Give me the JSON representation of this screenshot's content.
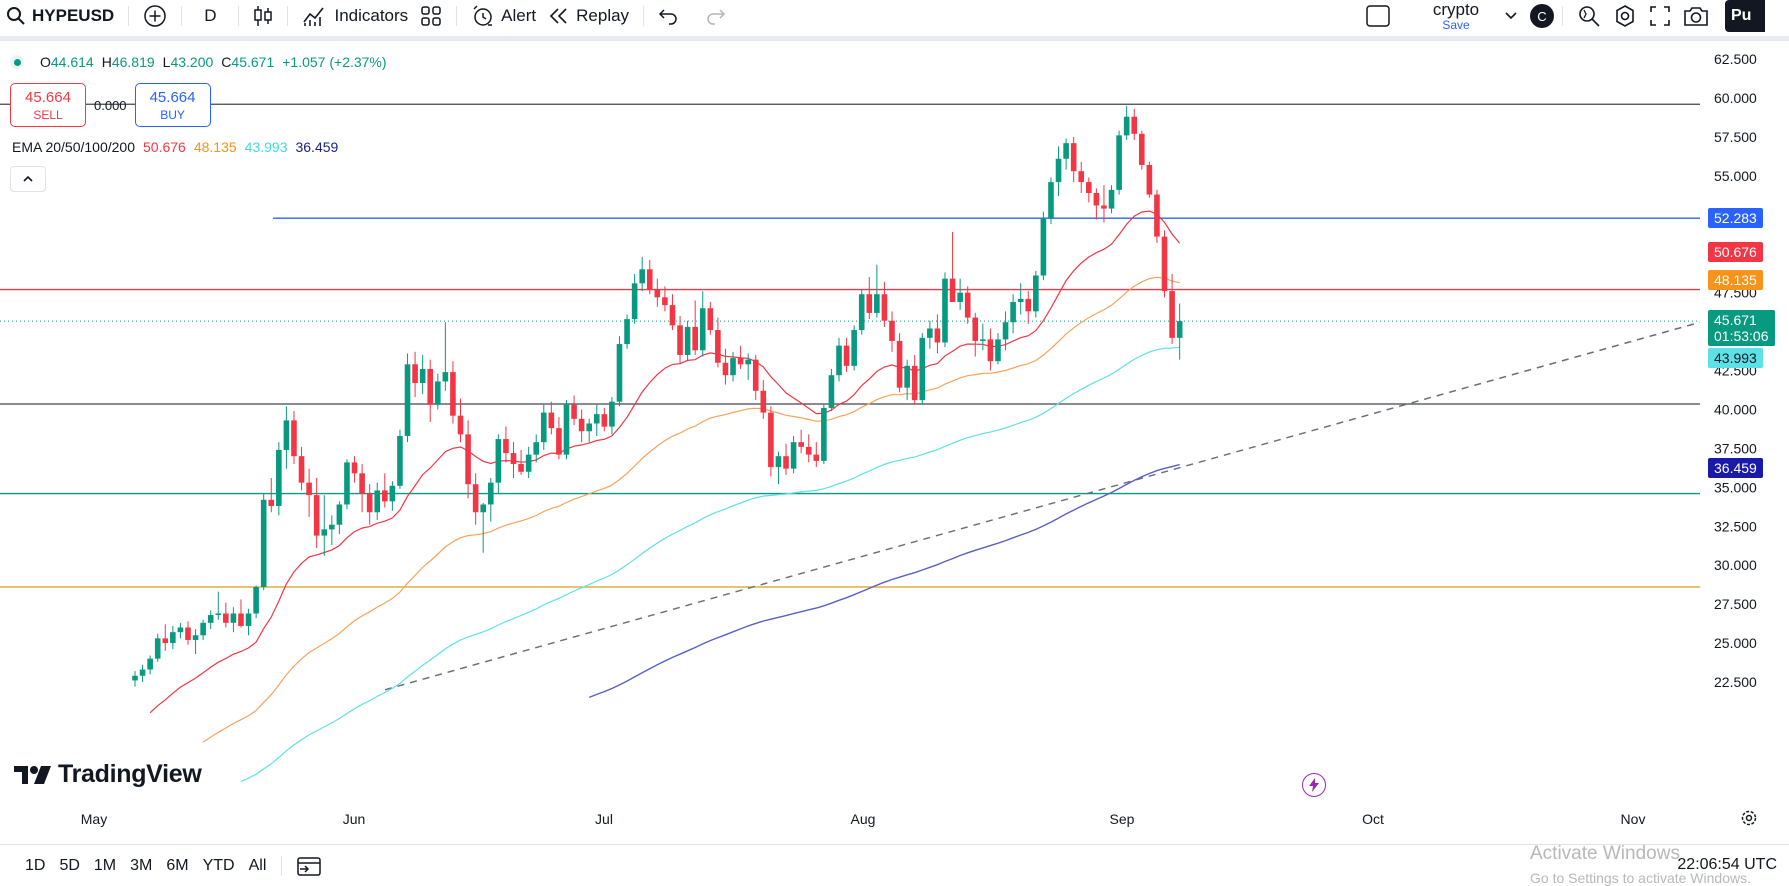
{
  "toolbar": {
    "symbol": "HYPEUSD",
    "interval": "D",
    "indicators_label": "Indicators",
    "alert_label": "Alert",
    "replay_label": "Replay",
    "layout_name": "crypto",
    "layout_save": "Save",
    "avatar_letter": "C",
    "publish_label": "Pu"
  },
  "legend": {
    "o_key": "O",
    "o_val": "44.614",
    "h_key": "H",
    "h_val": "46.819",
    "l_key": "L",
    "l_val": "43.200",
    "c_key": "C",
    "c_val": "45.671",
    "change": "+1.057 (+2.37%)",
    "sell_price": "45.664",
    "sell_label": "SELL",
    "spread": "0.000",
    "buy_price": "45.664",
    "buy_label": "BUY",
    "ema_label": "EMA 20/50/100/200",
    "ema_vals": [
      "50.676",
      "48.135",
      "43.993",
      "36.459"
    ]
  },
  "price_axis": {
    "ticks": [
      "62.500",
      "60.000",
      "57.500",
      "55.000",
      "52.500",
      "50.000",
      "47.500",
      "45.000",
      "42.500",
      "40.000",
      "37.500",
      "35.000",
      "32.500",
      "30.000",
      "27.500",
      "25.000",
      "22.500"
    ],
    "tags": {
      "line_52": "52.283",
      "ema20": "50.676",
      "ema50": "48.135",
      "last": "45.671",
      "countdown": "01:53:06",
      "ema100": "43.993",
      "ema200": "36.459"
    }
  },
  "time_axis": {
    "labels": [
      "May",
      "Jun",
      "Jul",
      "Aug",
      "Sep",
      "Oct",
      "Nov"
    ]
  },
  "bottom": {
    "ranges": [
      "1D",
      "5D",
      "1M",
      "3M",
      "6M",
      "YTD",
      "All"
    ],
    "clock": "22:06:54 UTC",
    "watermark_line1": "Activate Windows",
    "watermark_line2": "Go to Settings to activate Windows."
  },
  "logo": {
    "text": "TradingView"
  },
  "colors": {
    "up": "#089981",
    "down": "#f23645",
    "ema20": "#f23645",
    "ema50": "#f7a35c",
    "ema100": "#5ce1e6",
    "ema200": "#5b5fc7",
    "h_blue": "#2962ff",
    "h_red": "#f23645",
    "h_green": "#089981",
    "h_gold": "#d4a017",
    "h_gray": "#434651"
  },
  "chart_data": {
    "type": "candlestick",
    "symbol": "HYPEUSD",
    "interval": "D",
    "ylim": [
      21.5,
      63.5
    ],
    "x_labels": [
      "May",
      "Jun",
      "Jul",
      "Aug",
      "Sep",
      "Oct",
      "Nov"
    ],
    "candles": [
      [
        22.6,
        23.2,
        22.2,
        22.9
      ],
      [
        22.9,
        23.6,
        22.5,
        23.3
      ],
      [
        23.3,
        24.2,
        23.0,
        24.0
      ],
      [
        24.0,
        25.6,
        23.8,
        25.3
      ],
      [
        25.3,
        26.2,
        24.5,
        25.0
      ],
      [
        25.0,
        26.1,
        24.6,
        25.7
      ],
      [
        25.7,
        26.3,
        25.3,
        26.0
      ],
      [
        26.0,
        26.4,
        24.9,
        25.2
      ],
      [
        25.2,
        25.9,
        24.3,
        25.5
      ],
      [
        25.5,
        26.5,
        25.2,
        26.3
      ],
      [
        26.3,
        27.1,
        25.9,
        26.8
      ],
      [
        26.8,
        28.3,
        26.5,
        26.9
      ],
      [
        26.9,
        27.6,
        26.0,
        26.3
      ],
      [
        26.3,
        27.3,
        25.7,
        26.9
      ],
      [
        26.9,
        27.8,
        26.0,
        26.1
      ],
      [
        26.1,
        27.2,
        25.5,
        26.9
      ],
      [
        26.9,
        28.7,
        26.6,
        28.6
      ],
      [
        28.6,
        34.6,
        28.4,
        34.2
      ],
      [
        34.2,
        35.6,
        33.4,
        33.8
      ],
      [
        33.8,
        37.9,
        33.2,
        37.4
      ],
      [
        37.4,
        40.2,
        36.2,
        39.3
      ],
      [
        39.3,
        39.9,
        36.5,
        37.0
      ],
      [
        37.0,
        37.6,
        34.8,
        35.3
      ],
      [
        35.3,
        36.2,
        33.1,
        34.5
      ],
      [
        34.5,
        35.6,
        31.1,
        31.9
      ],
      [
        31.9,
        34.5,
        30.6,
        32.3
      ],
      [
        32.3,
        33.2,
        31.3,
        32.6
      ],
      [
        32.6,
        34.1,
        32.0,
        33.9
      ],
      [
        33.9,
        36.8,
        33.6,
        36.6
      ],
      [
        36.6,
        37.0,
        35.3,
        35.9
      ],
      [
        35.9,
        36.5,
        33.4,
        34.6
      ],
      [
        34.6,
        35.2,
        32.6,
        33.4
      ],
      [
        33.4,
        35.3,
        32.9,
        34.8
      ],
      [
        34.8,
        35.9,
        33.7,
        34.1
      ],
      [
        34.1,
        35.4,
        33.5,
        35.1
      ],
      [
        35.1,
        38.7,
        34.9,
        38.3
      ],
      [
        38.3,
        43.6,
        37.9,
        42.9
      ],
      [
        42.9,
        43.7,
        40.8,
        41.7
      ],
      [
        41.7,
        43.5,
        41.0,
        42.6
      ],
      [
        42.6,
        43.2,
        39.2,
        40.3
      ],
      [
        40.3,
        42.3,
        40.0,
        41.8
      ],
      [
        41.8,
        45.6,
        41.2,
        42.4
      ],
      [
        42.4,
        43.1,
        39.1,
        39.6
      ],
      [
        39.6,
        40.7,
        37.9,
        38.4
      ],
      [
        38.4,
        39.3,
        34.3,
        35.2
      ],
      [
        35.2,
        35.9,
        32.6,
        33.4
      ],
      [
        33.4,
        34.0,
        30.8,
        33.9
      ],
      [
        33.9,
        35.6,
        32.8,
        35.3
      ],
      [
        35.3,
        38.4,
        34.6,
        38.1
      ],
      [
        38.1,
        38.9,
        36.6,
        37.2
      ],
      [
        37.2,
        37.9,
        35.6,
        36.5
      ],
      [
        36.5,
        37.4,
        35.8,
        36.0
      ],
      [
        36.0,
        37.6,
        35.6,
        37.1
      ],
      [
        37.1,
        38.4,
        36.6,
        37.9
      ],
      [
        37.9,
        40.3,
        37.4,
        39.8
      ],
      [
        39.8,
        40.5,
        38.4,
        38.8
      ],
      [
        38.8,
        39.5,
        36.8,
        37.1
      ],
      [
        37.1,
        40.6,
        36.8,
        40.3
      ],
      [
        40.3,
        40.9,
        39.0,
        39.4
      ],
      [
        39.4,
        40.0,
        37.9,
        38.6
      ],
      [
        38.6,
        39.4,
        37.9,
        39.1
      ],
      [
        39.1,
        40.3,
        38.3,
        39.7
      ],
      [
        39.7,
        40.1,
        38.6,
        38.9
      ],
      [
        38.9,
        40.8,
        38.4,
        40.5
      ],
      [
        40.5,
        44.7,
        40.2,
        44.2
      ],
      [
        44.2,
        46.1,
        43.9,
        45.8
      ],
      [
        45.8,
        48.7,
        45.5,
        48.1
      ],
      [
        48.1,
        49.8,
        47.6,
        49.0
      ],
      [
        49.0,
        49.6,
        47.4,
        47.7
      ],
      [
        47.7,
        48.4,
        46.6,
        47.2
      ],
      [
        47.2,
        47.9,
        46.3,
        46.7
      ],
      [
        46.7,
        47.4,
        45.1,
        45.4
      ],
      [
        45.4,
        46.0,
        42.9,
        43.5
      ],
      [
        43.5,
        45.7,
        43.1,
        45.3
      ],
      [
        45.3,
        47.0,
        43.5,
        43.8
      ],
      [
        43.8,
        47.6,
        43.4,
        46.5
      ],
      [
        46.5,
        46.9,
        44.8,
        45.1
      ],
      [
        45.1,
        45.9,
        42.7,
        43.0
      ],
      [
        43.0,
        43.9,
        41.6,
        42.2
      ],
      [
        42.2,
        43.7,
        41.8,
        43.3
      ],
      [
        43.3,
        44.1,
        42.6,
        42.9
      ],
      [
        42.9,
        43.6,
        41.9,
        43.2
      ],
      [
        43.2,
        43.5,
        40.6,
        41.2
      ],
      [
        41.2,
        41.9,
        39.4,
        39.8
      ],
      [
        39.8,
        40.2,
        35.7,
        36.3
      ],
      [
        36.3,
        37.3,
        35.2,
        37.0
      ],
      [
        37.0,
        37.8,
        35.8,
        36.2
      ],
      [
        36.2,
        38.3,
        35.9,
        37.9
      ],
      [
        37.9,
        38.7,
        37.2,
        37.6
      ],
      [
        37.6,
        38.4,
        36.6,
        37.1
      ],
      [
        37.1,
        37.9,
        36.3,
        36.7
      ],
      [
        36.7,
        40.3,
        36.5,
        40.1
      ],
      [
        40.1,
        42.6,
        39.9,
        42.2
      ],
      [
        42.2,
        44.6,
        41.8,
        44.1
      ],
      [
        44.1,
        44.6,
        42.4,
        42.8
      ],
      [
        42.8,
        45.4,
        42.5,
        45.1
      ],
      [
        45.1,
        47.7,
        44.8,
        47.4
      ],
      [
        47.4,
        48.5,
        45.8,
        46.2
      ],
      [
        46.2,
        49.3,
        45.9,
        47.4
      ],
      [
        47.4,
        48.2,
        45.3,
        45.7
      ],
      [
        45.7,
        46.3,
        43.7,
        44.4
      ],
      [
        44.4,
        44.9,
        41.1,
        41.4
      ],
      [
        41.4,
        43.2,
        40.6,
        42.8
      ],
      [
        42.8,
        43.5,
        40.3,
        40.6
      ],
      [
        40.6,
        44.9,
        40.3,
        44.6
      ],
      [
        44.6,
        45.7,
        43.9,
        45.2
      ],
      [
        45.2,
        46.1,
        43.6,
        44.3
      ],
      [
        44.3,
        48.8,
        44.0,
        48.4
      ],
      [
        48.4,
        51.4,
        46.9,
        46.9
      ],
      [
        46.9,
        48.4,
        46.4,
        47.5
      ],
      [
        47.5,
        47.9,
        45.5,
        45.9
      ],
      [
        45.9,
        46.2,
        43.4,
        44.4
      ],
      [
        44.4,
        45.5,
        43.8,
        44.5
      ],
      [
        44.5,
        45.2,
        42.5,
        43.1
      ],
      [
        43.1,
        44.9,
        42.9,
        44.5
      ],
      [
        44.5,
        46.3,
        43.8,
        45.6
      ],
      [
        45.6,
        47.4,
        44.9,
        46.9
      ],
      [
        46.9,
        48.1,
        46.1,
        47.1
      ],
      [
        47.1,
        47.6,
        45.5,
        46.3
      ],
      [
        46.3,
        48.9,
        45.9,
        48.6
      ],
      [
        48.6,
        52.7,
        48.3,
        52.3
      ],
      [
        52.3,
        54.9,
        51.9,
        54.6
      ],
      [
        54.6,
        56.9,
        53.7,
        56.1
      ],
      [
        56.1,
        57.4,
        55.4,
        57.1
      ],
      [
        57.1,
        57.5,
        54.6,
        55.3
      ],
      [
        55.3,
        55.9,
        53.9,
        54.6
      ],
      [
        54.6,
        54.9,
        53.3,
        53.9
      ],
      [
        53.9,
        54.2,
        52.2,
        53.1
      ],
      [
        53.1,
        54.4,
        52.0,
        52.9
      ],
      [
        52.9,
        54.4,
        52.6,
        54.1
      ],
      [
        54.1,
        57.9,
        53.8,
        57.6
      ],
      [
        57.6,
        59.5,
        57.3,
        58.8
      ],
      [
        58.8,
        59.3,
        57.3,
        57.7
      ],
      [
        57.7,
        57.9,
        55.4,
        55.7
      ],
      [
        55.7,
        55.9,
        53.6,
        53.8
      ],
      [
        53.8,
        54.1,
        50.7,
        51.1
      ],
      [
        51.1,
        51.5,
        47.2,
        47.6
      ],
      [
        47.6,
        48.7,
        44.2,
        44.6
      ],
      [
        44.6,
        46.8,
        43.2,
        45.67
      ]
    ],
    "ema": {
      "periods": [
        20,
        50,
        100,
        200
      ],
      "last_values": [
        50.676,
        48.135,
        43.993,
        36.459
      ]
    },
    "horizontal_lines": [
      59.6,
      52.283,
      47.7,
      40.35,
      34.6,
      28.6
    ],
    "trendline": {
      "from": [
        22.0
      ],
      "to": [
        45.6
      ]
    }
  }
}
